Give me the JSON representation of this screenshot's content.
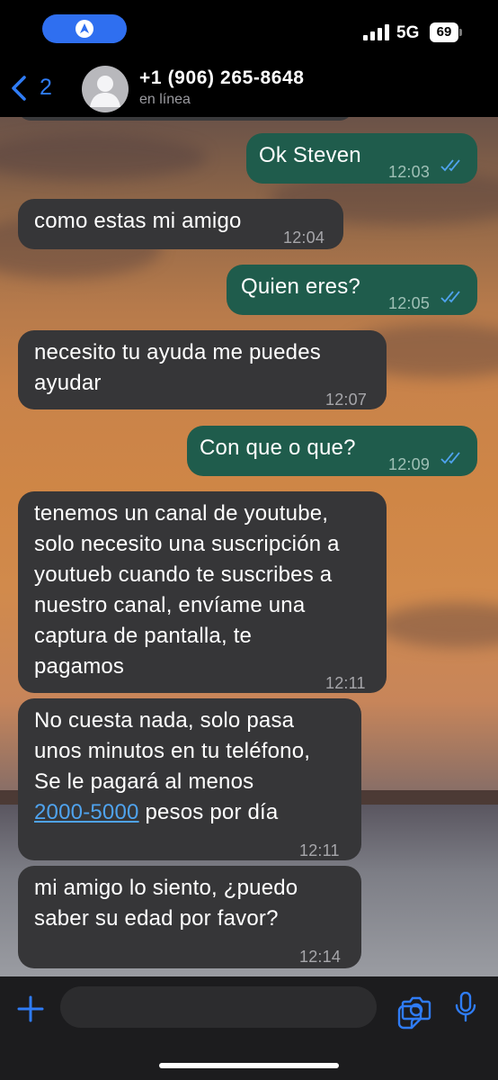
{
  "status_bar": {
    "network": "5G",
    "battery": "69"
  },
  "header": {
    "back_count": "2",
    "contact": "+1 (906) 265-8648",
    "presence": "en línea"
  },
  "messages": [
    {
      "dir": "out",
      "text": "Ok Steven",
      "time": "12:03",
      "read": true
    },
    {
      "dir": "in",
      "text": "como estas mi amigo",
      "time": "12:04"
    },
    {
      "dir": "out",
      "text": "Quien eres?",
      "time": "12:05",
      "read": true
    },
    {
      "dir": "in",
      "text": "necesito tu ayuda me puedes\nayudar",
      "time": "12:07"
    },
    {
      "dir": "out",
      "text": "Con que o que?",
      "time": "12:09",
      "read": true
    },
    {
      "dir": "in",
      "text": "tenemos un canal de youtube,\nsolo necesito una suscripción a\nyoutueb cuando te suscribes a\nnuestro canal, envíame una\ncaptura de pantalla, te\npagamos",
      "time": "12:11"
    },
    {
      "dir": "in",
      "text_before": "No cuesta nada, solo pasa\nunos minutos en tu teléfono,\nSe le pagará al menos\n",
      "link": "2000-5000",
      "text_after": " pesos por día",
      "time": "12:11"
    },
    {
      "dir": "in",
      "text": "mi amigo lo siento, ¿puedo\nsaber su edad por favor?",
      "time": "12:14"
    }
  ],
  "icons": {
    "back": "chevron-left-icon",
    "avatar": "default-avatar-icon",
    "plus": "plus-icon",
    "sticker": "sticker-icon",
    "camera": "camera-icon",
    "mic": "microphone-icon",
    "read_receipt": "double-check-icon"
  },
  "colors": {
    "accent": "#2f7cf6",
    "incoming_bubble": "#363638",
    "outgoing_bubble": "#1f5c4c",
    "link": "#4fa3ee"
  }
}
